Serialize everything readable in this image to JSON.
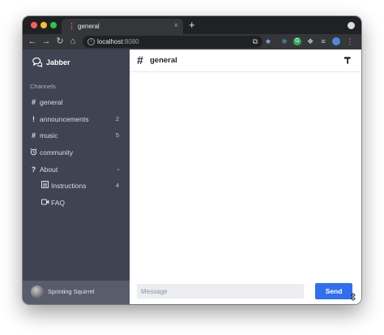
{
  "browser": {
    "tab_title": "general",
    "tab_close": "×",
    "new_tab": "+",
    "url_host": "localhost",
    "url_port": ":8080"
  },
  "app": {
    "name": "Jabber"
  },
  "sidebar": {
    "heading": "Channels",
    "items": [
      {
        "icon": "hash-icon",
        "label": "general",
        "count": ""
      },
      {
        "icon": "exclamation-icon",
        "label": "announcements",
        "count": "2"
      },
      {
        "icon": "hash-icon",
        "label": "music",
        "count": "5"
      },
      {
        "icon": "alarm-clock-icon",
        "label": "community",
        "count": ""
      },
      {
        "icon": "question-icon",
        "label": "About",
        "count": ""
      },
      {
        "icon": "list-icon",
        "label": "Instructions",
        "count": "4"
      },
      {
        "icon": "video-icon",
        "label": "FAQ",
        "count": ""
      }
    ]
  },
  "user": {
    "name": "Sprinting Squirrel"
  },
  "main": {
    "channel_title": "general"
  },
  "composer": {
    "placeholder": "Message",
    "send_label": "Send"
  },
  "colors": {
    "sidebar_bg": "#3f4452",
    "user_bar_bg": "#575d6b",
    "accent": "#2f6ff0"
  }
}
